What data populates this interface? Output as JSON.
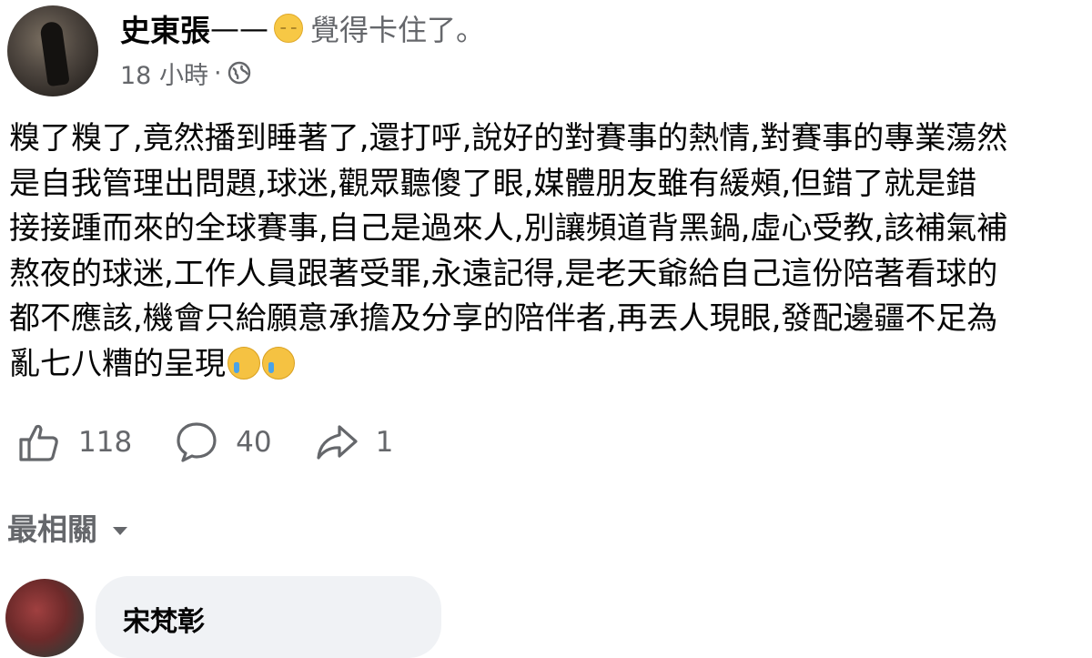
{
  "post": {
    "author": "史東張",
    "feeling_dash": "——",
    "feeling_emoji": "pensive-face-emoji",
    "feeling_text": "覺得卡住了。",
    "time": "18 小時",
    "separator": "·",
    "privacy_icon": "globe-icon",
    "lines": [
      "糗了糗了,竟然播到睡著了,還打呼,說好的對賽事的熱情,對賽事的專業蕩然",
      "是自我管理出問題,球迷,觀眾聽傻了眼,媒體朋友雖有緩頰,但錯了就是錯",
      "接接踵而來的全球賽事,自己是過來人,別讓頻道背黑鍋,虛心受教,該補氣補",
      "熬夜的球迷,工作人員跟著受罪,永遠記得,是老天爺給自己這份陪著看球的",
      "都不應該,機會只給願意承擔及分享的陪伴者,再丟人現眼,發配邊疆不足為",
      "亂七八糟的呈現"
    ],
    "end_emojis": [
      "crying-face-emoji",
      "crying-face-emoji"
    ]
  },
  "actions": {
    "like": {
      "icon": "thumbs-up-icon",
      "count": "118"
    },
    "comment": {
      "icon": "speech-bubble-icon",
      "count": "40"
    },
    "share": {
      "icon": "share-arrow-icon",
      "count": "1"
    }
  },
  "comments": {
    "sort_label": "最相關",
    "sort_icon": "caret-down-icon",
    "first_author": "宋梵彰"
  }
}
